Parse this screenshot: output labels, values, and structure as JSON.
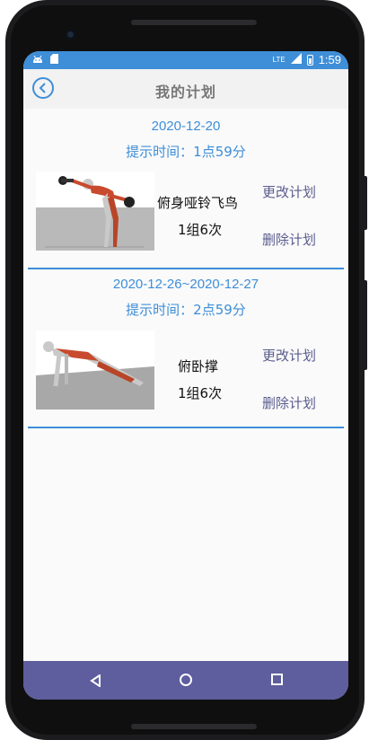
{
  "status_bar": {
    "network": "LTE",
    "time": "1:59"
  },
  "header": {
    "title": "我的计划"
  },
  "plans": [
    {
      "date": "2020-12-20",
      "remind": "提示时间：1点59分",
      "exercise": "俯身哑铃飞鸟",
      "sets": "1组6次",
      "edit_label": "更改计划",
      "delete_label": "删除计划"
    },
    {
      "date": "2020-12-26~2020-12-27",
      "remind": "提示时间：2点59分",
      "exercise": "俯卧撑",
      "sets": "1组6次",
      "edit_label": "更改计划",
      "delete_label": "删除计划"
    }
  ],
  "colors": {
    "accent": "#3e8ed8",
    "nav": "#5e5d9e",
    "action": "#5a5c8e"
  }
}
